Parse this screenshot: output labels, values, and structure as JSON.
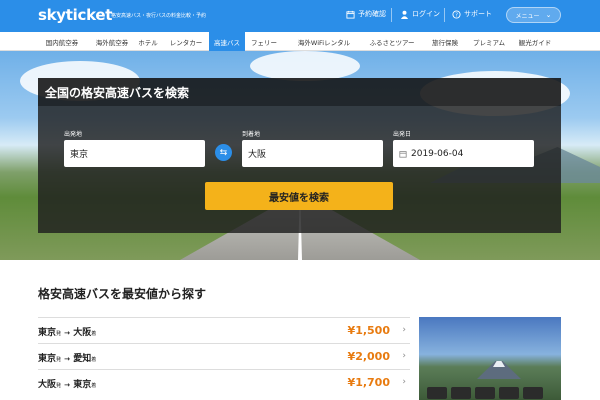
{
  "header": {
    "logo": "skyticket",
    "tagline": "格安高速バス・夜行バスの料金比較・予約",
    "reservation_label": "予約確認",
    "login_label": "ログイン",
    "support_label": "サポート",
    "menu_label": "メニュー"
  },
  "nav": {
    "items": [
      "国内航空券",
      "海外航空券",
      "ホテル",
      "レンタカー",
      "高速バス",
      "フェリー",
      "海外WiFiレンタル",
      "ふるさとツアー",
      "旅行保険",
      "プレミアム",
      "観光ガイド"
    ],
    "active_index": 4
  },
  "search": {
    "title": "全国の格安高速バスを検索",
    "origin_label": "出発地",
    "origin_value": "東京",
    "destination_label": "到着地",
    "destination_value": "大阪",
    "date_label": "出発日",
    "date_value": "2019-06-04",
    "button_label": "最安値を検索"
  },
  "routes": {
    "title": "格安高速バスを最安値から探す",
    "from_suffix": "発",
    "to_suffix": "着",
    "items": [
      {
        "from": "東京",
        "to": "大阪",
        "price": "¥1,500"
      },
      {
        "from": "東京",
        "to": "愛知",
        "price": "¥2,000"
      },
      {
        "from": "大阪",
        "to": "東京",
        "price": "¥1,700"
      }
    ]
  },
  "colors": {
    "brand": "#2b8ee8",
    "cta": "#f4b21a",
    "price": "#e87b10"
  }
}
